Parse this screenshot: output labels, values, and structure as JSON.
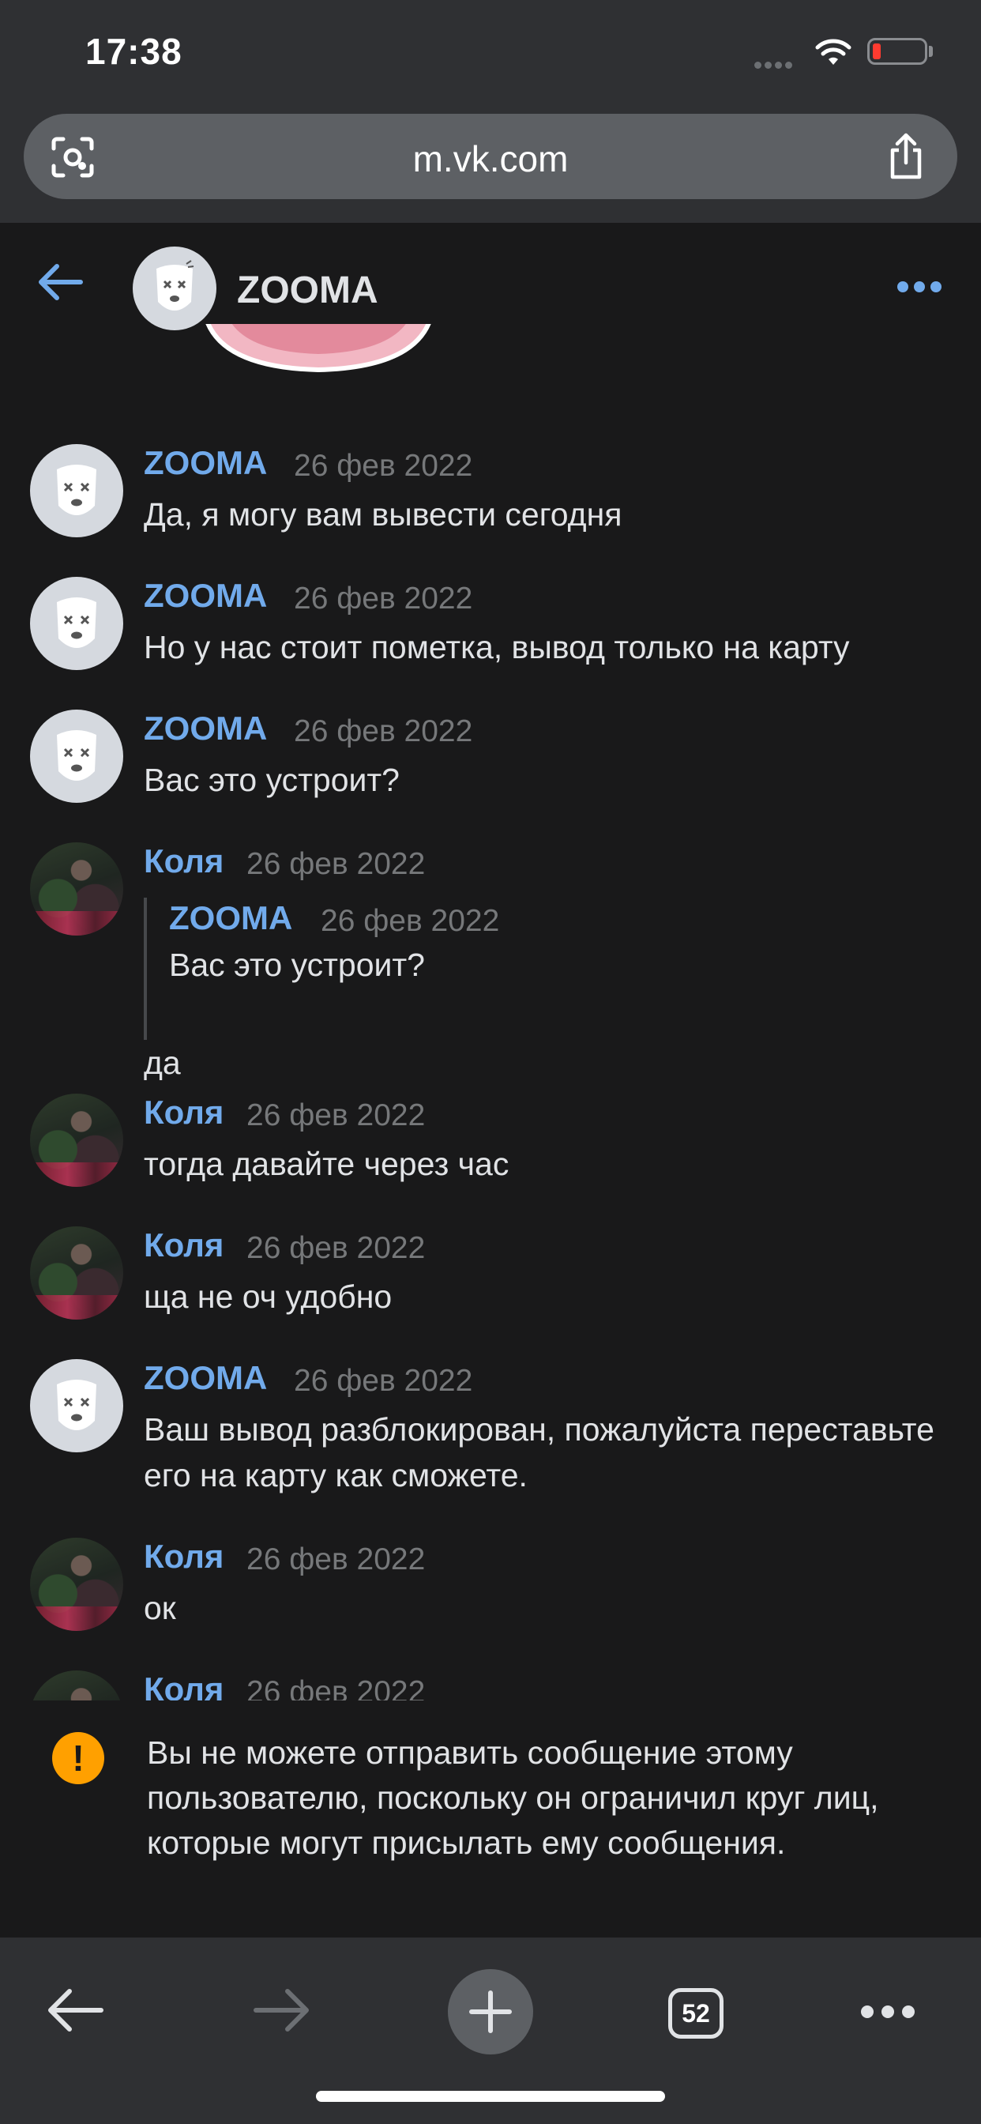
{
  "status_bar": {
    "time": "17:38"
  },
  "browser": {
    "url": "m.vk.com",
    "open_tabs_count": "52"
  },
  "chat": {
    "title": "ZOOMA"
  },
  "messages": [
    {
      "author": "ZOOMA",
      "date": "26 фев 2022",
      "text": "Да, я могу вам вывести сегодня",
      "avatar": "bear"
    },
    {
      "author": "ZOOMA",
      "date": "26 фев 2022",
      "text": "Но у нас стоит пометка, вывод только на карту",
      "avatar": "bear"
    },
    {
      "author": "ZOOMA",
      "date": "26 фев 2022",
      "text": "Вас это устроит?",
      "avatar": "bear"
    },
    {
      "author": "Коля",
      "date": "26 фев 2022",
      "text": "да",
      "avatar": "photo",
      "quote": {
        "author": "ZOOMA",
        "date": "26 фев 2022",
        "text": "Вас это устроит?"
      }
    },
    {
      "author": "Коля",
      "date": "26 фев 2022",
      "text": "тогда давайте через час",
      "avatar": "photo"
    },
    {
      "author": "Коля",
      "date": "26 фев 2022",
      "text": "ща не оч удобно",
      "avatar": "photo"
    },
    {
      "author": "ZOOMA",
      "date": "26 фев 2022",
      "text": "Ваш вывод разблокирован, пожалуйста переставьте его на карту как сможете.",
      "avatar": "bear"
    },
    {
      "author": "Коля",
      "date": "26 фев 2022",
      "text": "ок",
      "avatar": "photo"
    },
    {
      "author": "Коля",
      "date": "26 фев 2022",
      "text": "",
      "avatar": "photo"
    }
  ],
  "notice": {
    "text": "Вы не можете отправить сообщение этому пользователю, поскольку он ограничил круг лиц, которые могут присылать ему сообщения.",
    "icon": "warning-icon",
    "icon_color": "#ffa000"
  },
  "colors": {
    "accent": "#71aaeb",
    "background": "#19191a",
    "bars": "#2f3033"
  }
}
